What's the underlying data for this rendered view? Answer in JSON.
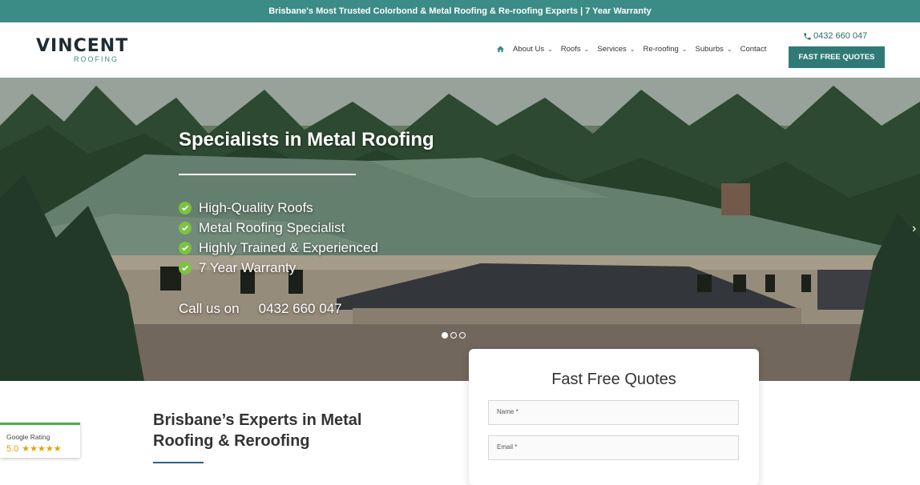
{
  "topbar": {
    "text": "Brisbane's Most Trusted Colorbond & Metal Roofing & Re-roofing Experts | 7 Year Warranty"
  },
  "brand": {
    "name": "VINCENT",
    "tagline": "ROOFING",
    "accent": "#3b8b86"
  },
  "header": {
    "phone": "0432 660 047",
    "cta": "FAST FREE QUOTES",
    "nav": [
      {
        "label": "About Us",
        "dropdown": true
      },
      {
        "label": "Roofs",
        "dropdown": true
      },
      {
        "label": "Services",
        "dropdown": true
      },
      {
        "label": "Re-roofing",
        "dropdown": true
      },
      {
        "label": "Suburbs",
        "dropdown": true
      },
      {
        "label": "Contact",
        "dropdown": false
      }
    ]
  },
  "hero": {
    "title": "Specialists in Metal Roofing",
    "features": [
      "High-Quality Roofs",
      "Metal Roofing Specialist",
      "Highly Trained & Experienced",
      "7 Year Warranty"
    ],
    "call_prefix": "Call us on",
    "call_number": "0432 660 047",
    "slide_count": 3,
    "active_slide": 1
  },
  "quote_form": {
    "title": "Fast Free Quotes",
    "name_placeholder": "Name *",
    "email_placeholder": "Email *"
  },
  "intro": {
    "title": "Brisbane’s Experts in Metal Roofing & Reroofing"
  },
  "google": {
    "label": "Google Rating",
    "score": "5.0",
    "stars": "★★★★★"
  }
}
